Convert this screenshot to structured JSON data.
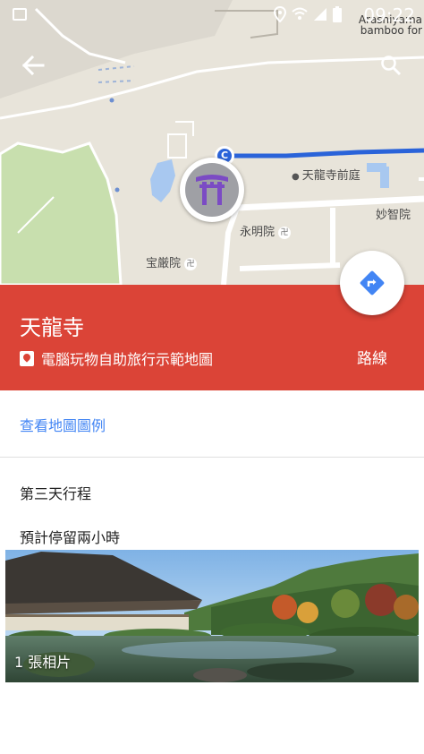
{
  "status_bar": {
    "time": "09:22",
    "map_attribution": "Arashiyama bamboo for",
    "icons": [
      "image-icon",
      "location-icon",
      "wifi-icon",
      "signal-icon",
      "battery-icon"
    ]
  },
  "map": {
    "labels": {
      "tenryuji_maeniwa": "天龍寺前庭",
      "myochiin": "妙智院",
      "eimyoin": "永明院",
      "hogonin": "宝厳院"
    },
    "route_start_marker": "C",
    "route_color": "#2a63d9"
  },
  "place": {
    "title": "天龍寺",
    "map_name": "電腦玩物自助旅行示範地圖",
    "directions_label": "路線",
    "header_color": "#db4437"
  },
  "legend_link": "查看地圖圖例",
  "description": {
    "line1": "第三天行程",
    "line2": "預計停留兩小時"
  },
  "photo": {
    "count_label": "1 張相片"
  }
}
